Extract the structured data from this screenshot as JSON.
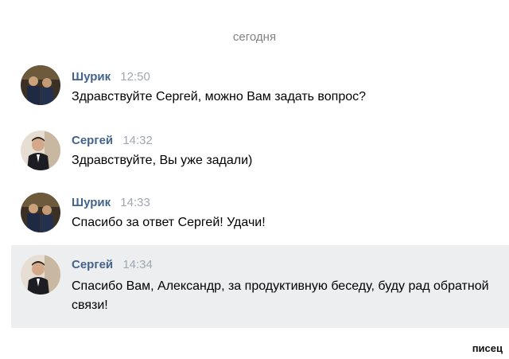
{
  "date_separator": "сегодня",
  "messages": [
    {
      "author": "Шурик",
      "time": "12:50",
      "text": "Здравствуйте Сергей, можно Вам задать вопрос?"
    },
    {
      "author": "Сергей",
      "time": "14:32",
      "text": "Здравствуйте, Вы уже задали)"
    },
    {
      "author": "Шурик",
      "time": "14:33",
      "text": "Спасибо за ответ Сергей! Удачи!"
    },
    {
      "author": "Сергей",
      "time": "14:34",
      "text": "Спасибо Вам, Александр, за продуктивную беседу, буду рад обратной связи!"
    }
  ],
  "watermark": "писец",
  "colors": {
    "author": "#42648b",
    "time": "#a0a8b3",
    "highlight": "#edeef0"
  }
}
